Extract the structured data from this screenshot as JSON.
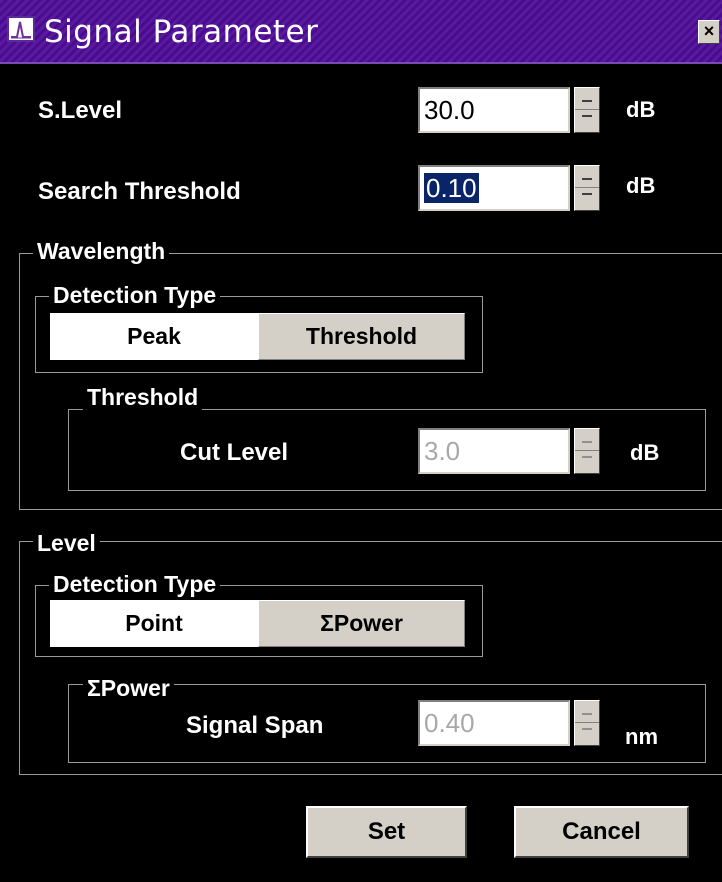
{
  "window": {
    "title": "Signal Parameter",
    "close_label": "×",
    "title_color": "#4a0c8e"
  },
  "s_level": {
    "label": "S.Level",
    "value": "30.0",
    "unit": "dB"
  },
  "search_threshold": {
    "label": "Search Threshold",
    "value": "0.10",
    "unit": "dB"
  },
  "wavelength": {
    "group_label": "Wavelength",
    "detection_type": {
      "label": "Detection Type",
      "options": [
        "Peak",
        "Threshold"
      ],
      "selected": "Threshold"
    },
    "threshold": {
      "group_label": "Threshold",
      "cut_level_label": "Cut Level",
      "cut_level_value": "3.0",
      "unit": "dB"
    }
  },
  "level": {
    "group_label": "Level",
    "detection_type": {
      "label": "Detection Type",
      "options": [
        "Point",
        "ΣPower"
      ],
      "selected": "ΣPower"
    },
    "power": {
      "group_label": "ΣPower",
      "signal_span_label": "Signal Span",
      "signal_span_value": "0.40",
      "unit": "nm"
    }
  },
  "buttons": {
    "set": "Set",
    "cancel": "Cancel"
  }
}
